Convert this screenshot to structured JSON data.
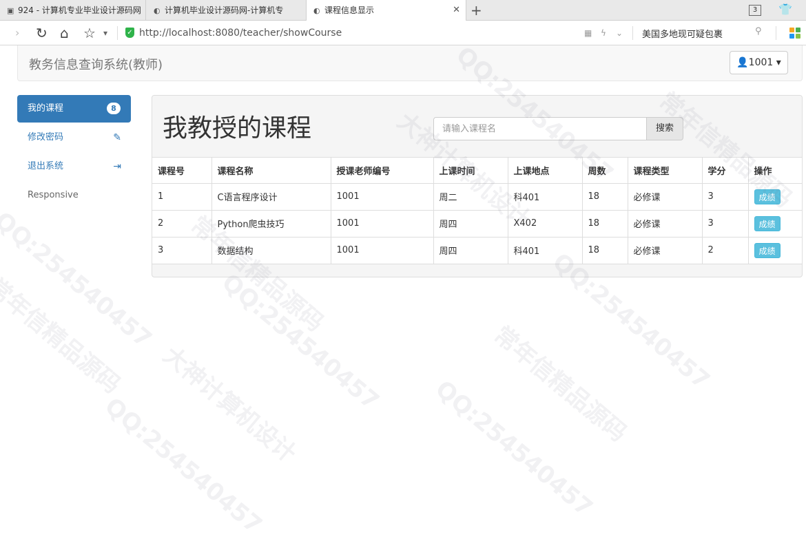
{
  "browser": {
    "tabs": [
      {
        "label": "924 - 计算机专业毕业设计源码网"
      },
      {
        "label": "计算机毕业设计源码网-计算机专"
      },
      {
        "label": "课程信息显示"
      }
    ],
    "tab_count": "3",
    "url_host": "http://localhost",
    "url_rest": ":8080/teacher/showCourse",
    "search_hint": "美国多地现可疑包裹"
  },
  "header": {
    "brand": "教务信息查询系统(教师)",
    "user": "1001"
  },
  "sidebar": {
    "items": [
      {
        "label": "我的课程",
        "badge": "8"
      },
      {
        "label": "修改密码"
      },
      {
        "label": "退出系统"
      },
      {
        "label": "Responsive"
      }
    ]
  },
  "main": {
    "title": "我教授的课程",
    "search_placeholder": "请输入课程名",
    "search_button": "搜索",
    "columns": [
      "课程号",
      "课程名称",
      "授课老师编号",
      "上课时间",
      "上课地点",
      "周数",
      "课程类型",
      "学分",
      "操作"
    ],
    "rows": [
      [
        "1",
        "C语言程序设计",
        "1001",
        "周二",
        "科401",
        "18",
        "必修课",
        "3",
        "成绩"
      ],
      [
        "2",
        "Python爬虫技巧",
        "1001",
        "周四",
        "X402",
        "18",
        "必修课",
        "3",
        "成绩"
      ],
      [
        "3",
        "数据结构",
        "1001",
        "周四",
        "科401",
        "18",
        "必修课",
        "2",
        "成绩"
      ]
    ]
  },
  "watermark": {
    "texts": [
      "QQ:254540457",
      "大神计算机设计",
      "常年信精品源码"
    ]
  }
}
